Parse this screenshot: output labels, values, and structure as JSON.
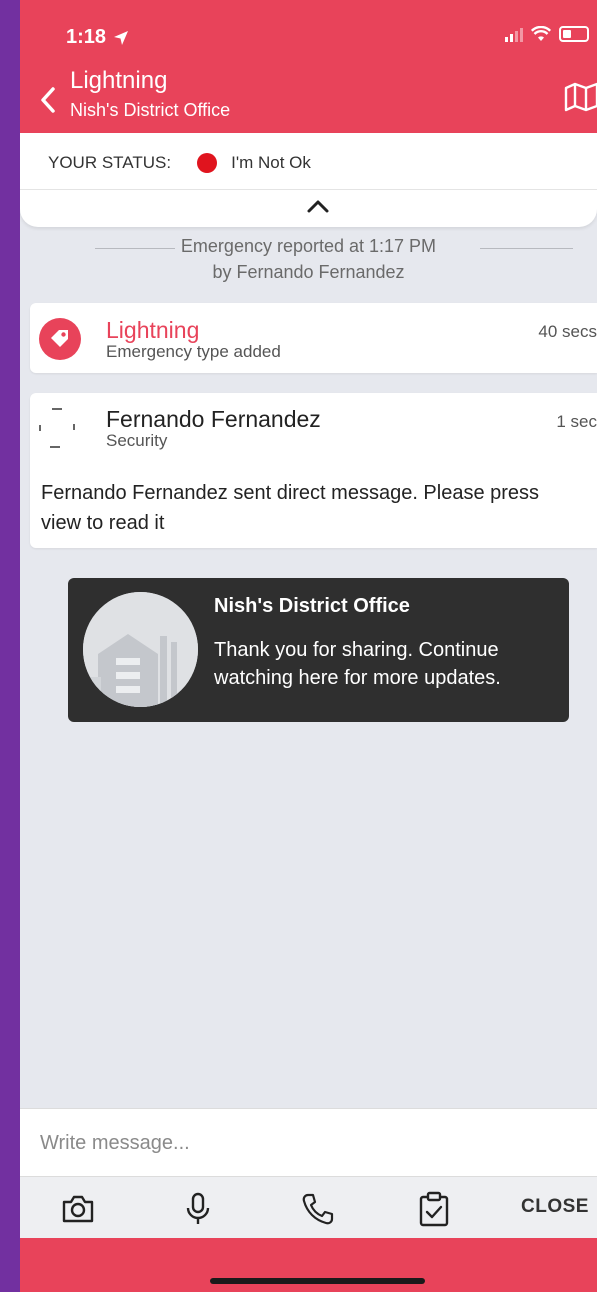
{
  "status_bar": {
    "time": "1:18"
  },
  "header": {
    "title": "Lightning",
    "subtitle": "Nish's District Office"
  },
  "your_status": {
    "label": "YOUR STATUS:",
    "value": "I'm Not Ok",
    "dot_color": "#e0141e"
  },
  "event": {
    "reported": "Emergency reported at 1:17 PM",
    "by": "by Fernando Fernandez"
  },
  "cards": [
    {
      "title": "Lightning",
      "subtitle": "Emergency type added",
      "time": "40 secs"
    },
    {
      "title": "Fernando Fernandez",
      "subtitle": "Security",
      "time": "1 sec",
      "message": "Fernando Fernandez sent direct message. Please press view to read it"
    }
  ],
  "toast": {
    "title": "Nish's District Office",
    "body": "Thank you for sharing. Continue watching here for more updates."
  },
  "composer": {
    "placeholder": "Write message..."
  },
  "toolbar": {
    "close_label": "CLOSE"
  },
  "colors": {
    "accent": "#e8435a",
    "toast_bg": "#2f2f2f",
    "background": "#e6e8ee"
  }
}
